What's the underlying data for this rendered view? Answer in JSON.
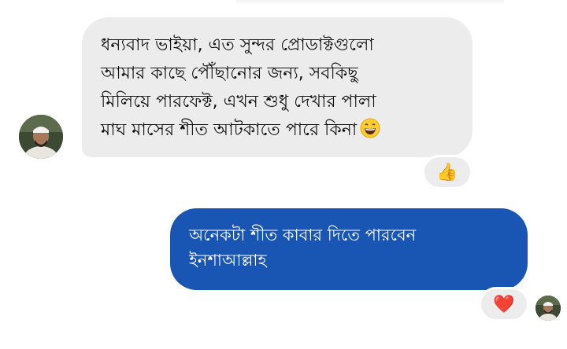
{
  "conversation": {
    "incoming_message": {
      "lines": [
        "ধন্যবাদ ভাইয়া, এত সুন্দর প্রোডাক্টগুলো",
        "আমার কাছে পৌঁছানোর জন্য, সবকিছু",
        "মিলিয়ে পারফেক্ট, এখন শুধু দেখার পালা",
        "মাঘ মাসের শীত আটকাতে পারে কিনা"
      ],
      "emoji": "grinning-face",
      "reaction": "👍"
    },
    "outgoing_message": {
      "lines": [
        "অনেকটা শীত কাবার  দিতে পারবেন",
        "ইনশাআল্লাহ"
      ],
      "reaction": "❤️"
    }
  },
  "colors": {
    "incoming_bubble": "#ececec",
    "outgoing_bubble": "#1956b4",
    "outgoing_text": "#ffffff"
  },
  "icons": {
    "sender_avatar": "profile-photo-icon",
    "seen_indicator": "seen-avatar-icon"
  }
}
